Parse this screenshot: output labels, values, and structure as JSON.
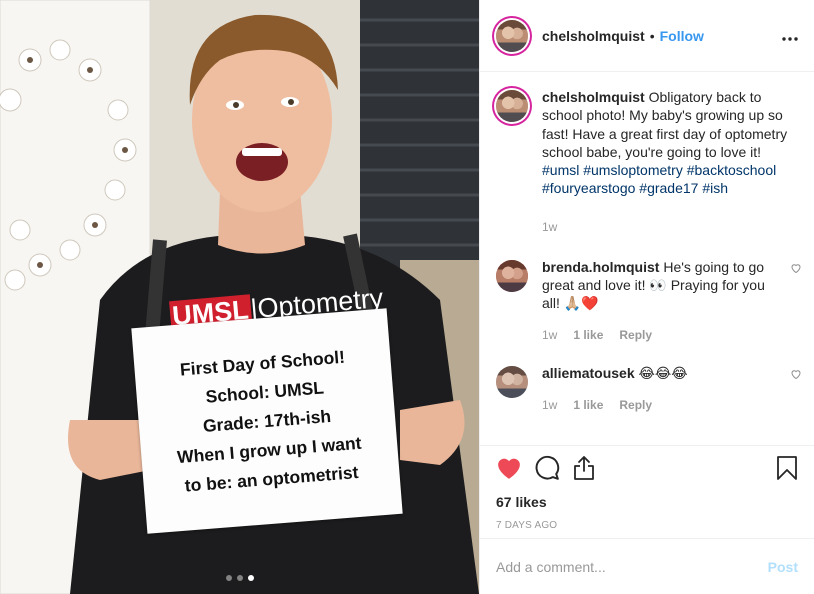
{
  "photo": {
    "sign_text": "First Day of School!\nSchool: UMSL\nGrade: 17th-ish\nWhen I grow up I want\nto be: an optometrist",
    "shirt_logo_red": "UMSL",
    "shirt_logo_rest": "|Optometry",
    "carousel_dots": 3,
    "active_dot": 3
  },
  "header": {
    "username": "chelsholmquist",
    "separator": "•",
    "follow_label": "Follow",
    "more_label": "•••"
  },
  "caption": {
    "username": "chelsholmquist",
    "text": "Obligatory back to school photo! My baby's growing up so fast! Have a great first day of optometry school babe, you're going to love it!",
    "hashtags": "#umsl #umsloptometry #backtoschool #fouryearstogo #grade17 #ish",
    "age": "1w"
  },
  "comments": [
    {
      "username": "brenda.holmquist",
      "text": "He's going to go great and love it! 👀 Praying for you all! 🙏🏼❤️",
      "age": "1w",
      "likes": "1 like",
      "reply_label": "Reply"
    },
    {
      "username": "alliematousek",
      "text": "😂😂😂",
      "age": "1w",
      "likes": "1 like",
      "reply_label": "Reply"
    }
  ],
  "actions": {
    "liked": true,
    "icons": [
      "heart-icon",
      "comment-icon",
      "share-icon",
      "bookmark-icon"
    ]
  },
  "likes_count": "67 likes",
  "timestamp": "7 DAYS AGO",
  "add_comment": {
    "placeholder": "Add a comment...",
    "value": "",
    "post_label": "Post"
  },
  "colors": {
    "link": "#3897f0",
    "hashtag": "#003569",
    "like_red": "#ed4956",
    "muted": "#999999",
    "post_disabled": "#b2dffc"
  }
}
